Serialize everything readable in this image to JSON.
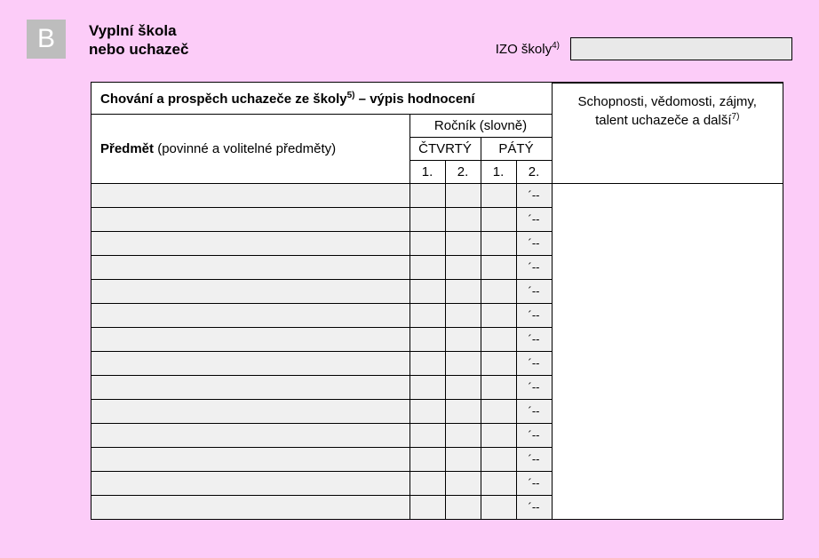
{
  "section_letter": "B",
  "title": {
    "line1": "Vyplní škola",
    "line2": "nebo uchazeč"
  },
  "izo": {
    "label": "IZO školy",
    "note": "4)",
    "value": ""
  },
  "heading": {
    "prefix": "Chování a prospěch uchazeče ze školy",
    "note": "5)",
    "suffix": " – výpis hodnocení"
  },
  "subject_header": {
    "bold": "Předmět",
    "rest": " (povinné a volitelné předměty)"
  },
  "year_header": "Ročník (slovně)",
  "grades": [
    "ČTVRTÝ",
    "PÁTÝ"
  ],
  "semesters": [
    "1.",
    "2.",
    "1.",
    "2."
  ],
  "right_column": {
    "line1": "Schopnosti, vědomosti, zájmy,",
    "line2": "talent uchazeče a další",
    "note": "7)"
  },
  "rows": [
    {
      "subject": "",
      "s1": "",
      "s2": "",
      "s3": "",
      "s4": "´--"
    },
    {
      "subject": "",
      "s1": "",
      "s2": "",
      "s3": "",
      "s4": "´--"
    },
    {
      "subject": "",
      "s1": "",
      "s2": "",
      "s3": "",
      "s4": "´--"
    },
    {
      "subject": "",
      "s1": "",
      "s2": "",
      "s3": "",
      "s4": "´--"
    },
    {
      "subject": "",
      "s1": "",
      "s2": "",
      "s3": "",
      "s4": "´--"
    },
    {
      "subject": "",
      "s1": "",
      "s2": "",
      "s3": "",
      "s4": "´--"
    },
    {
      "subject": "",
      "s1": "",
      "s2": "",
      "s3": "",
      "s4": "´--"
    },
    {
      "subject": "",
      "s1": "",
      "s2": "",
      "s3": "",
      "s4": "´--"
    },
    {
      "subject": "",
      "s1": "",
      "s2": "",
      "s3": "",
      "s4": "´--"
    },
    {
      "subject": "",
      "s1": "",
      "s2": "",
      "s3": "",
      "s4": "´--"
    },
    {
      "subject": "",
      "s1": "",
      "s2": "",
      "s3": "",
      "s4": "´--"
    },
    {
      "subject": "",
      "s1": "",
      "s2": "",
      "s3": "",
      "s4": "´--"
    },
    {
      "subject": "",
      "s1": "",
      "s2": "",
      "s3": "",
      "s4": "´--"
    },
    {
      "subject": "",
      "s1": "",
      "s2": "",
      "s3": "",
      "s4": "´--"
    }
  ]
}
